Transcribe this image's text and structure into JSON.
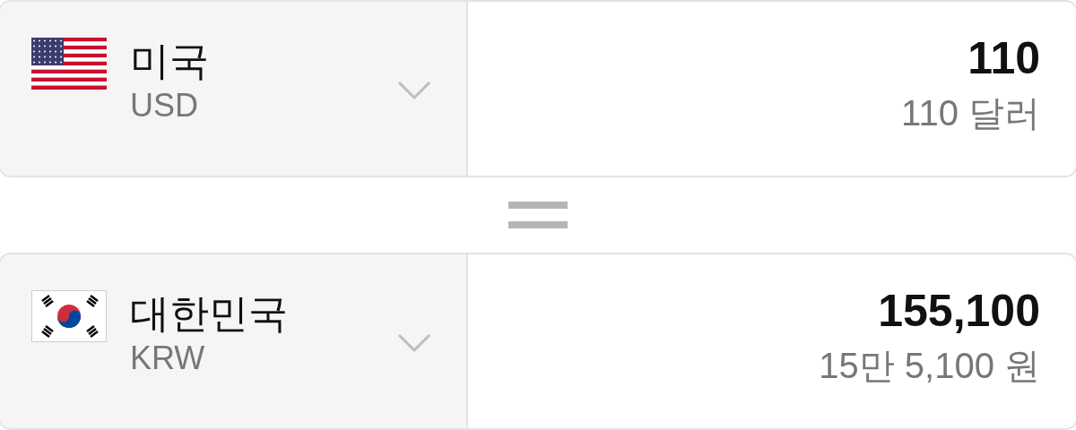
{
  "converters": [
    {
      "kind": "us",
      "country": "미국",
      "code": "USD",
      "amount": "110",
      "amount_words": "110 달러"
    },
    {
      "kind": "kr",
      "country": "대한민국",
      "code": "KRW",
      "amount": "155,100",
      "amount_words": "15만 5,100 원"
    }
  ]
}
